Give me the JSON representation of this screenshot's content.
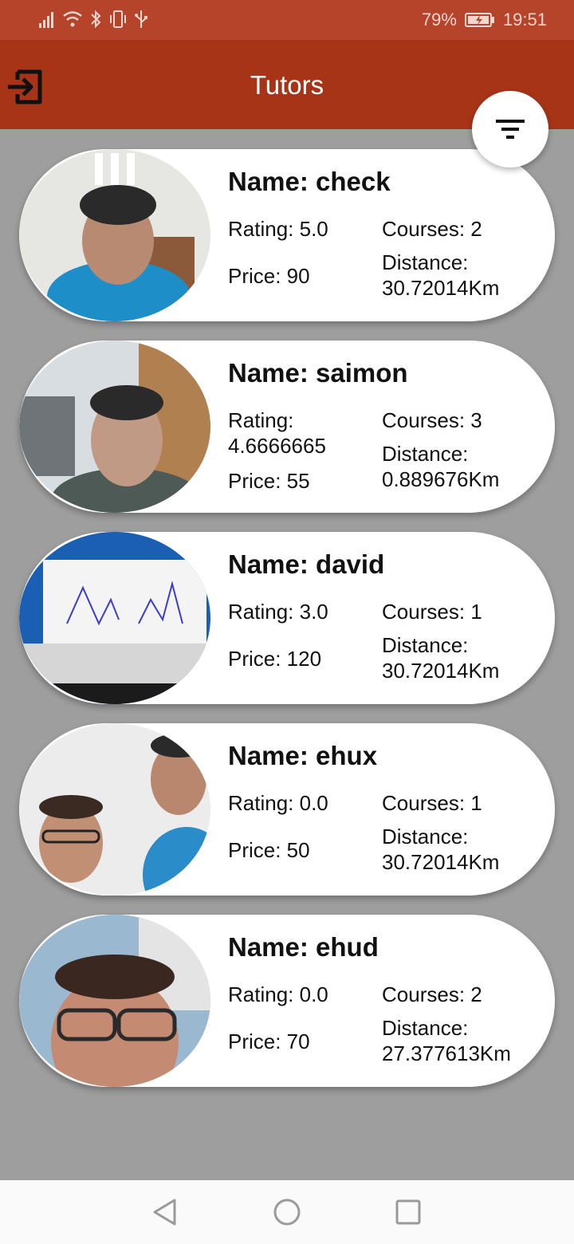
{
  "status_bar": {
    "battery": "79%",
    "time": "19:51",
    "icons": [
      "signal-icon",
      "wifi-icon",
      "bluetooth-icon",
      "vibrate-icon",
      "usb-icon",
      "battery-charging-icon"
    ]
  },
  "app_bar": {
    "title": "Tutors",
    "exit_icon": "exit-icon",
    "filter_icon": "filter-icon"
  },
  "tutors": [
    {
      "name": "Name: check",
      "rating": "Rating: 5.0",
      "price": "Price: 90",
      "courses": "Courses: 2",
      "distance": "Distance: 30.72014Km"
    },
    {
      "name": "Name: saimon",
      "rating": "Rating: 4.6666665",
      "price": "Price: 55",
      "courses": "Courses: 3",
      "distance": "Distance: 0.889676Km"
    },
    {
      "name": "Name: david",
      "rating": "Rating: 3.0",
      "price": "Price: 120",
      "courses": "Courses: 1",
      "distance": "Distance: 30.72014Km"
    },
    {
      "name": "Name: ehux",
      "rating": "Rating: 0.0",
      "price": "Price: 50",
      "courses": "Courses: 1",
      "distance": "Distance: 30.72014Km"
    },
    {
      "name": "Name: ehud",
      "rating": "Rating: 0.0",
      "price": "Price: 70",
      "courses": "Courses: 2",
      "distance": "Distance: 27.377613Km"
    }
  ],
  "nav_bar": {
    "icons": [
      "back-triangle-icon",
      "home-circle-icon",
      "recents-square-icon"
    ]
  },
  "colors": {
    "status_bar": "#b5442a",
    "app_bar": "#a83417",
    "background": "#9e9e9e",
    "card": "#ffffff"
  }
}
